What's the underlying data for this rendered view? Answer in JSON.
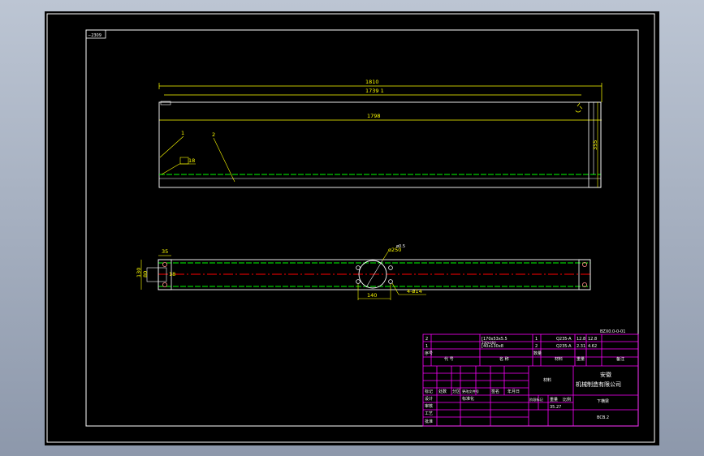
{
  "drawing": {
    "code_box": "−2309",
    "colors": {
      "background": "#000000",
      "frame": "#ffffff",
      "dimension": "#ffff00",
      "center_line": "#ff0000",
      "hidden": "#00ff00",
      "title_block": "#ff00ff"
    },
    "elevation": {
      "dim_overall": "1810",
      "dim_middle": "1739 1",
      "dim_inner": "1798",
      "dim_height": "355",
      "leader_1": "1",
      "leader_2": "2",
      "weld_symbol": "18"
    },
    "plan": {
      "dim_left_width": "35",
      "dim_total_height": "130",
      "dim_inner_height": "80",
      "dim_small": "18",
      "dim_circle": "ø250",
      "dim_bolt_spacing": "140",
      "hole_note": "4-ø14",
      "dim_small2": "ø0.5"
    },
    "title_block": {
      "drawing_no": "BZX0.0-0-01",
      "parts_row1": [
        "2",
        "[170x53x5.5",
        "1",
        "Q235-A",
        "12.8",
        "12.8"
      ],
      "parts_row2": [
        "1",
        "[40x130x8",
        "2",
        "Q235-A",
        "2.31",
        "4.62"
      ],
      "parts_note": "230x160",
      "header_left": [
        "序号",
        "代 号",
        "名 称"
      ],
      "header_right": [
        "数量",
        "材料",
        "重量",
        "备注"
      ],
      "company_line1": "安徽",
      "company_line2": "机械制造有限公司",
      "material": "材料",
      "rev_labels": [
        "标记",
        "处数",
        "分区",
        "更改文件号",
        "签名",
        "年月日"
      ],
      "sign_labels": [
        "设计",
        "审核",
        "工艺",
        "批准"
      ],
      "sign_col2": [
        "标准化"
      ],
      "stage_labels": [
        "阶段标记",
        "重量",
        "比例"
      ],
      "weight": "35.27",
      "part_name": "下横梁",
      "part_code": "BCB.2"
    }
  }
}
